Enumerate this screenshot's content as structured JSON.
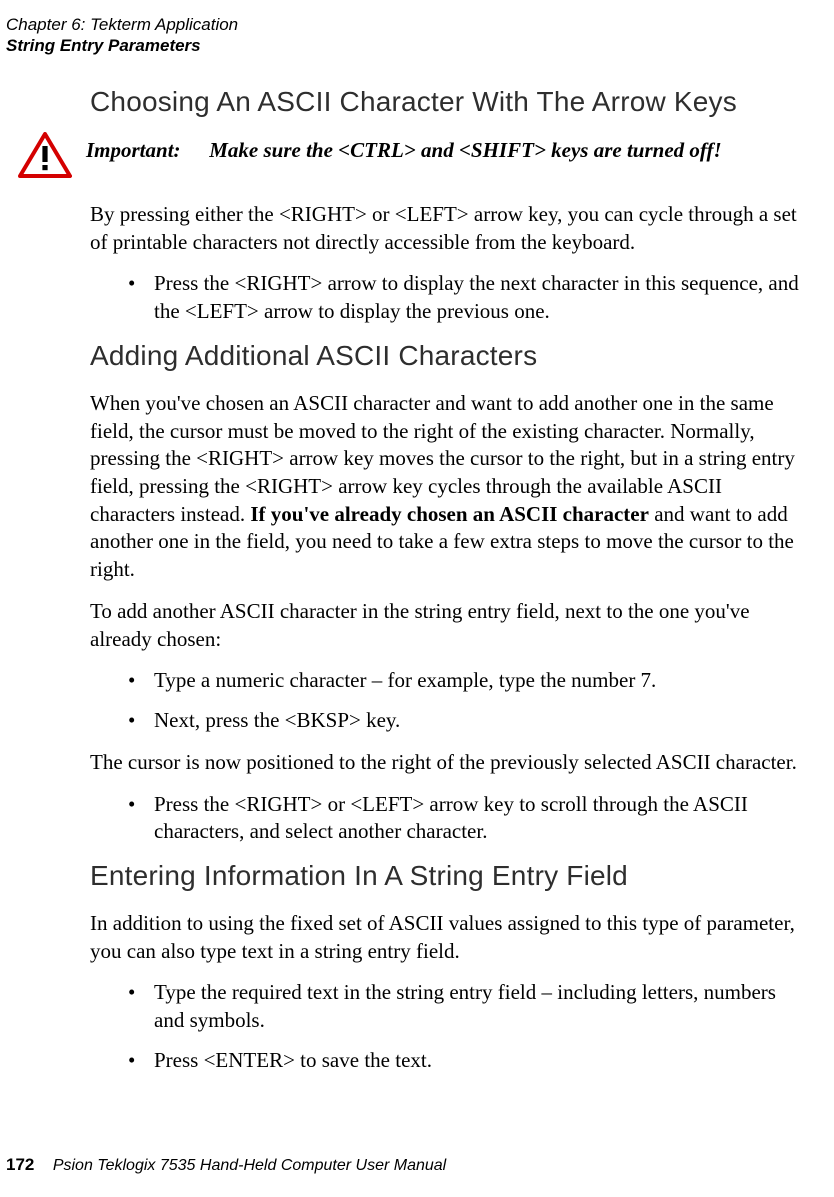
{
  "runningHead": {
    "chapter": "Chapter 6: Tekterm Application",
    "section": "String Entry Parameters"
  },
  "sections": {
    "choosing": {
      "title": "Choosing An ASCII Character With The Arrow Keys",
      "importantLabel": "Important:",
      "importantText": "Make sure the <CTRL> and  <SHIFT>  keys are turned off!",
      "para1": "By pressing either the <RIGHT> or <LEFT> arrow key, you can cycle through a set of printable characters not directly accessible from the keyboard.",
      "bullet1": "Press the <RIGHT> arrow to display the next character in this sequence, and the <LEFT> arrow to display the previous one."
    },
    "adding": {
      "title": "Adding Additional ASCII Characters",
      "para1_pre": "When you've chosen an ASCII character and want to add another one in the same field, the cursor must be moved to the right of the existing character. Normally, pressing the <RIGHT> arrow key moves the cursor to the right, but in a string entry field, pressing the <RIGHT> arrow key cycles through the available ASCII characters instead. ",
      "para1_bold": "If you've already chosen an ASCII character",
      "para1_post": " and want to add another one in the field, you need to take a few extra steps to move the cursor to the right.",
      "para2": "To add another ASCII character in the string entry field, next to the one you've already chosen:",
      "bullet1": "Type a numeric character – for example, type the number 7.",
      "bullet2": "Next, press the <BKSP> key.",
      "para3": "The cursor is now positioned to the right of the previously selected ASCII character.",
      "bullet3": "Press the <RIGHT> or <LEFT> arrow key to scroll through the ASCII characters, and select another character."
    },
    "entering": {
      "title": "Entering Information In A String Entry Field",
      "para1": "In addition to using the fixed set of ASCII values assigned to this type of parameter, you can also type text in a string entry field.",
      "bullet1": "Type the required text in the string entry field – including letters, numbers and symbols.",
      "bullet2": "Press <ENTER> to save the text."
    }
  },
  "footer": {
    "pageNumber": "172",
    "manualTitle": "Psion Teklogix 7535 Hand-Held Computer User Manual"
  }
}
